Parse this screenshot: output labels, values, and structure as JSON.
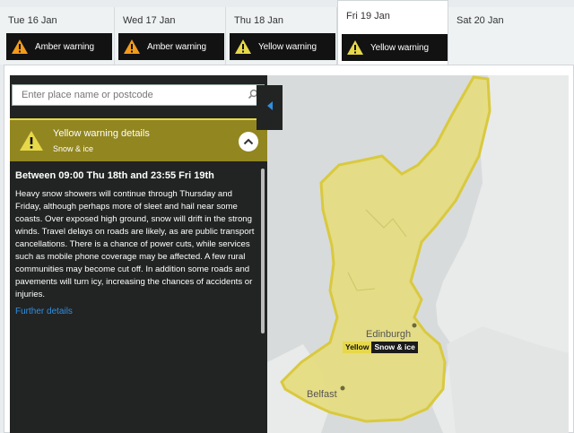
{
  "tabs": [
    {
      "day": "Tue 16 Jan",
      "warning": "Amber warning",
      "level": "amber"
    },
    {
      "day": "Wed 17 Jan",
      "warning": "Amber warning",
      "level": "amber"
    },
    {
      "day": "Thu 18 Jan",
      "warning": "Yellow warning",
      "level": "yellow"
    },
    {
      "day": "Fri 19 Jan",
      "warning": "Yellow warning",
      "level": "yellow",
      "active": true
    },
    {
      "day": "Sat 20 Jan"
    }
  ],
  "search": {
    "placeholder": "Enter place name or postcode",
    "icon": "search-icon"
  },
  "warning": {
    "title": "Yellow warning details",
    "type": "Snow & ice",
    "period": "Between 09:00 Thu 18th and 23:55 Fri 19th",
    "description": "Heavy snow showers will continue through Thursday and Friday, although perhaps more of sleet and hail near some coasts. Over exposed high ground, snow will drift in the strong winds. Travel delays on roads are likely, as are public transport cancellations. There is a chance of power cuts, while services such as mobile phone coverage may be affected. A few rural communities may become cut off. In addition some roads and pavements will turn icy, increasing the chances of accidents or injuries.",
    "link": "Further details"
  },
  "map": {
    "places": {
      "edinburgh": "Edinburgh",
      "belfast": "Belfast"
    },
    "label": {
      "level": "Yellow",
      "type": "Snow & ice"
    }
  },
  "colors": {
    "amber": "#f29b1d",
    "yellow": "#e6d84a",
    "panel": "#222323",
    "header": "#928620",
    "link": "#2f8fe0"
  }
}
